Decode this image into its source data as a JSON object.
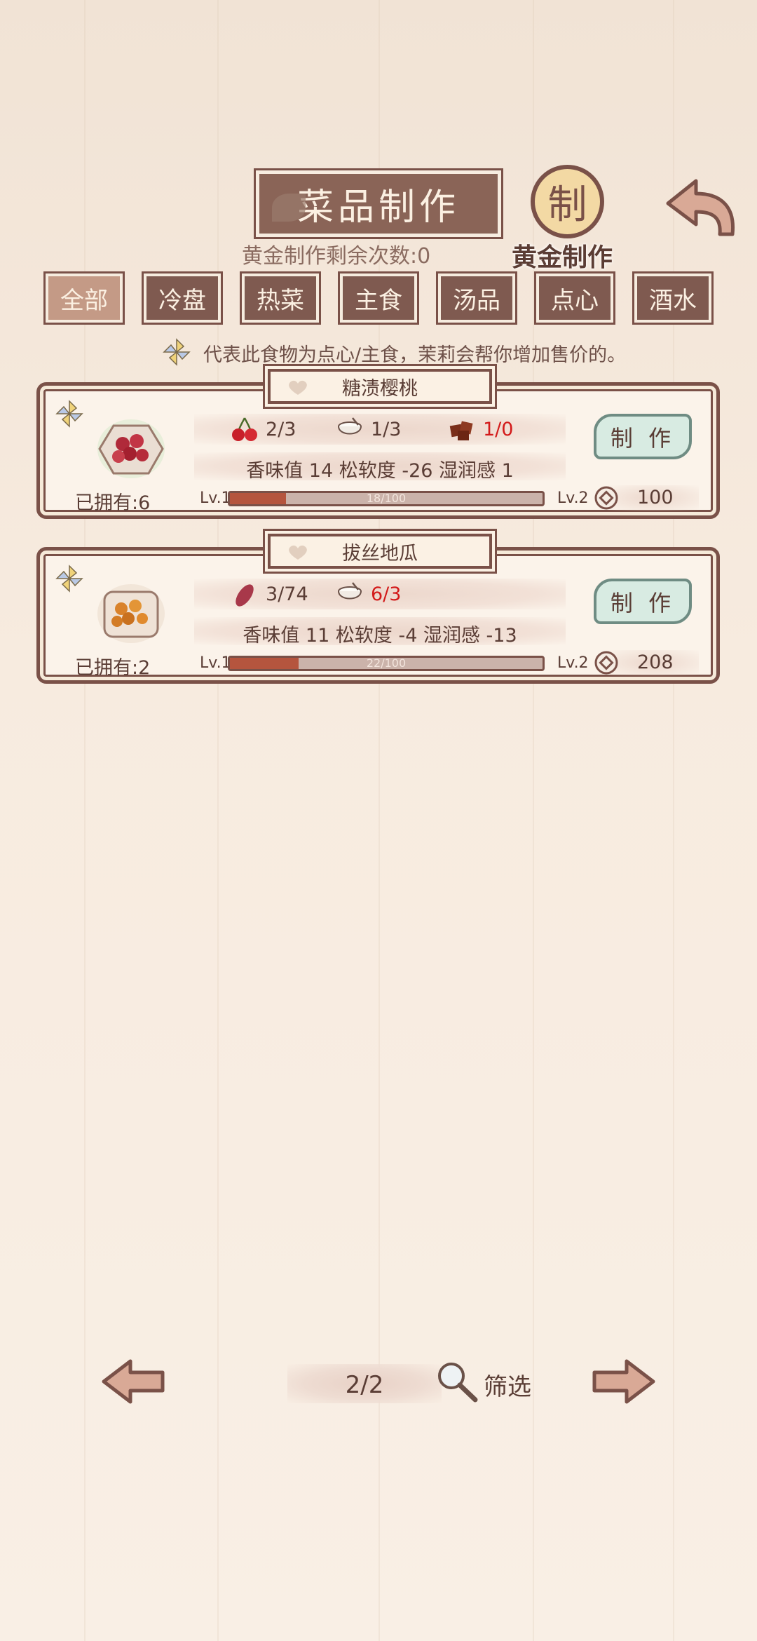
{
  "header": {
    "title": "菜品制作",
    "gold_remaining": "黄金制作剩余次数:0",
    "gold_emblem_char": "制",
    "gold_label": "黄金制作"
  },
  "tabs": [
    {
      "label": "全部",
      "active": true
    },
    {
      "label": "冷盘",
      "active": false
    },
    {
      "label": "热菜",
      "active": false
    },
    {
      "label": "主食",
      "active": false
    },
    {
      "label": "汤品",
      "active": false
    },
    {
      "label": "点心",
      "active": false
    },
    {
      "label": "酒水",
      "active": false
    }
  ],
  "hint": "代表此食物为点心/主食，茉莉会帮你增加售价的。",
  "dishes": [
    {
      "name": "糖渍樱桃",
      "owned": "已拥有:6",
      "ingredients": [
        {
          "icon": "cherry-icon",
          "count": "2/3",
          "lacking": false
        },
        {
          "icon": "sugar-bowl-icon",
          "count": "1/3",
          "lacking": false
        },
        {
          "icon": "brown-sugar-icon",
          "count": "1/0",
          "lacking": true
        }
      ],
      "stats": "香味值 14   松软度 -26   湿润感 1",
      "level_from": "Lv.1",
      "level_to": "Lv.2",
      "progress_text": "18/100",
      "progress": 0.18,
      "make_label": "制 作",
      "price": "100"
    },
    {
      "name": "拔丝地瓜",
      "owned": "已拥有:2",
      "ingredients": [
        {
          "icon": "sweet-potato-icon",
          "count": "3/74",
          "lacking": false
        },
        {
          "icon": "sugar-bowl-icon",
          "count": "6/3",
          "lacking": true
        }
      ],
      "stats": "香味值 11   松软度 -4   湿润感 -13",
      "level_from": "Lv.1",
      "level_to": "Lv.2",
      "progress_text": "22/100",
      "progress": 0.22,
      "make_label": "制 作",
      "price": "208"
    }
  ],
  "pagination": {
    "page": "2/2",
    "filter_label": "筛选"
  },
  "colors": {
    "frame": "#7a5148",
    "tab_bg": "#7f5a50",
    "tab_active": "#c49a86",
    "lack_red": "#d31a1a",
    "bar_fill": "#b5553e",
    "make_btn": "#d8ebe2"
  }
}
